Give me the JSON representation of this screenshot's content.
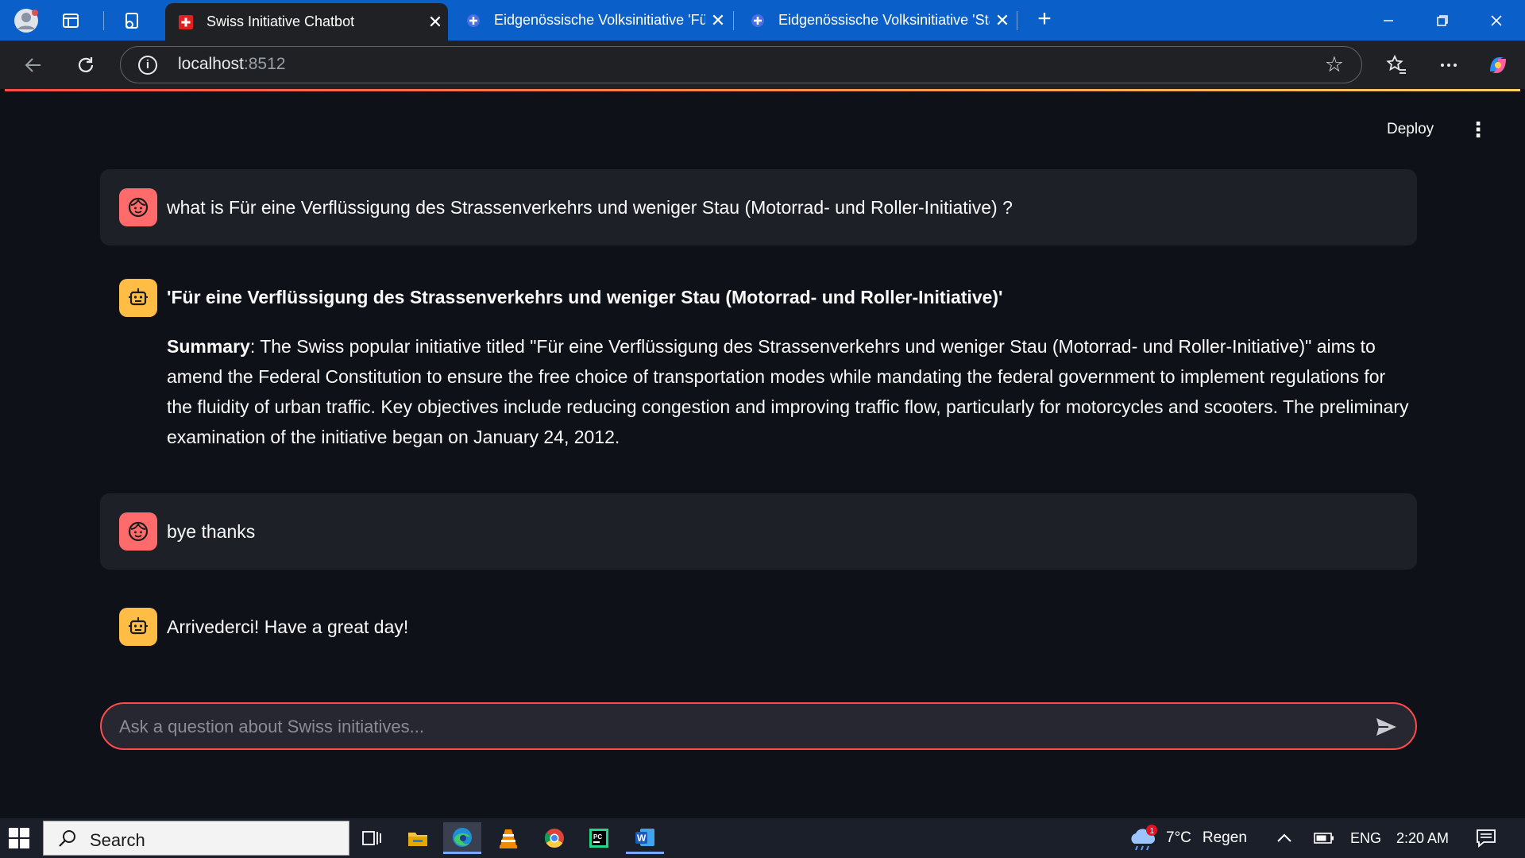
{
  "browser": {
    "tabs": [
      {
        "title": "Swiss Initiative Chatbot",
        "active": true
      },
      {
        "title": "Eidgenössische Volksinitiative 'Für",
        "active": false
      },
      {
        "title": "Eidgenössische Volksinitiative 'Sta",
        "active": false
      }
    ],
    "close_glyph": "✕",
    "newtab_glyph": "+",
    "url_host": "localhost",
    "url_port": ":8512"
  },
  "app": {
    "deploy_label": "Deploy",
    "menu_glyph": "⋮",
    "messages": [
      {
        "role": "user",
        "text": "what is Für eine Verflüssigung des Strassenverkehrs und weniger Stau (Motorrad- und Roller-Initiative) ?"
      },
      {
        "role": "assistant",
        "heading": "'Für eine Verflüssigung des Strassenverkehrs und weniger Stau (Motorrad- und Roller-Initiative)'",
        "summary_label": "Summary",
        "summary_text": ": The Swiss popular initiative titled \"Für eine Verflüssigung des Strassenverkehrs und weniger Stau (Motorrad- und Roller-Initiative)\" aims to amend the Federal Constitution to ensure the free choice of transportation modes while mandating the federal government to implement regulations for the fluidity of urban traffic. Key objectives include reducing congestion and improving traffic flow, particularly for motorcycles and scooters. The preliminary examination of the initiative began on January 24, 2012."
      },
      {
        "role": "user",
        "text": "bye thanks"
      },
      {
        "role": "assistant",
        "text": "Arrivederci! Have a great day!"
      }
    ],
    "input_placeholder": "Ask a question about Swiss initiatives..."
  },
  "taskbar": {
    "search_label": "Search",
    "weather_temp": "7°C",
    "weather_text": "Regen",
    "weather_badge": "1",
    "language": "ENG",
    "time": "2:20 AM"
  },
  "colors": {
    "accent": "#ff4b4b",
    "user_avatar": "#ff6b6b",
    "bot_avatar": "#ffbd45",
    "browser_chrome": "#0b5fc8"
  }
}
